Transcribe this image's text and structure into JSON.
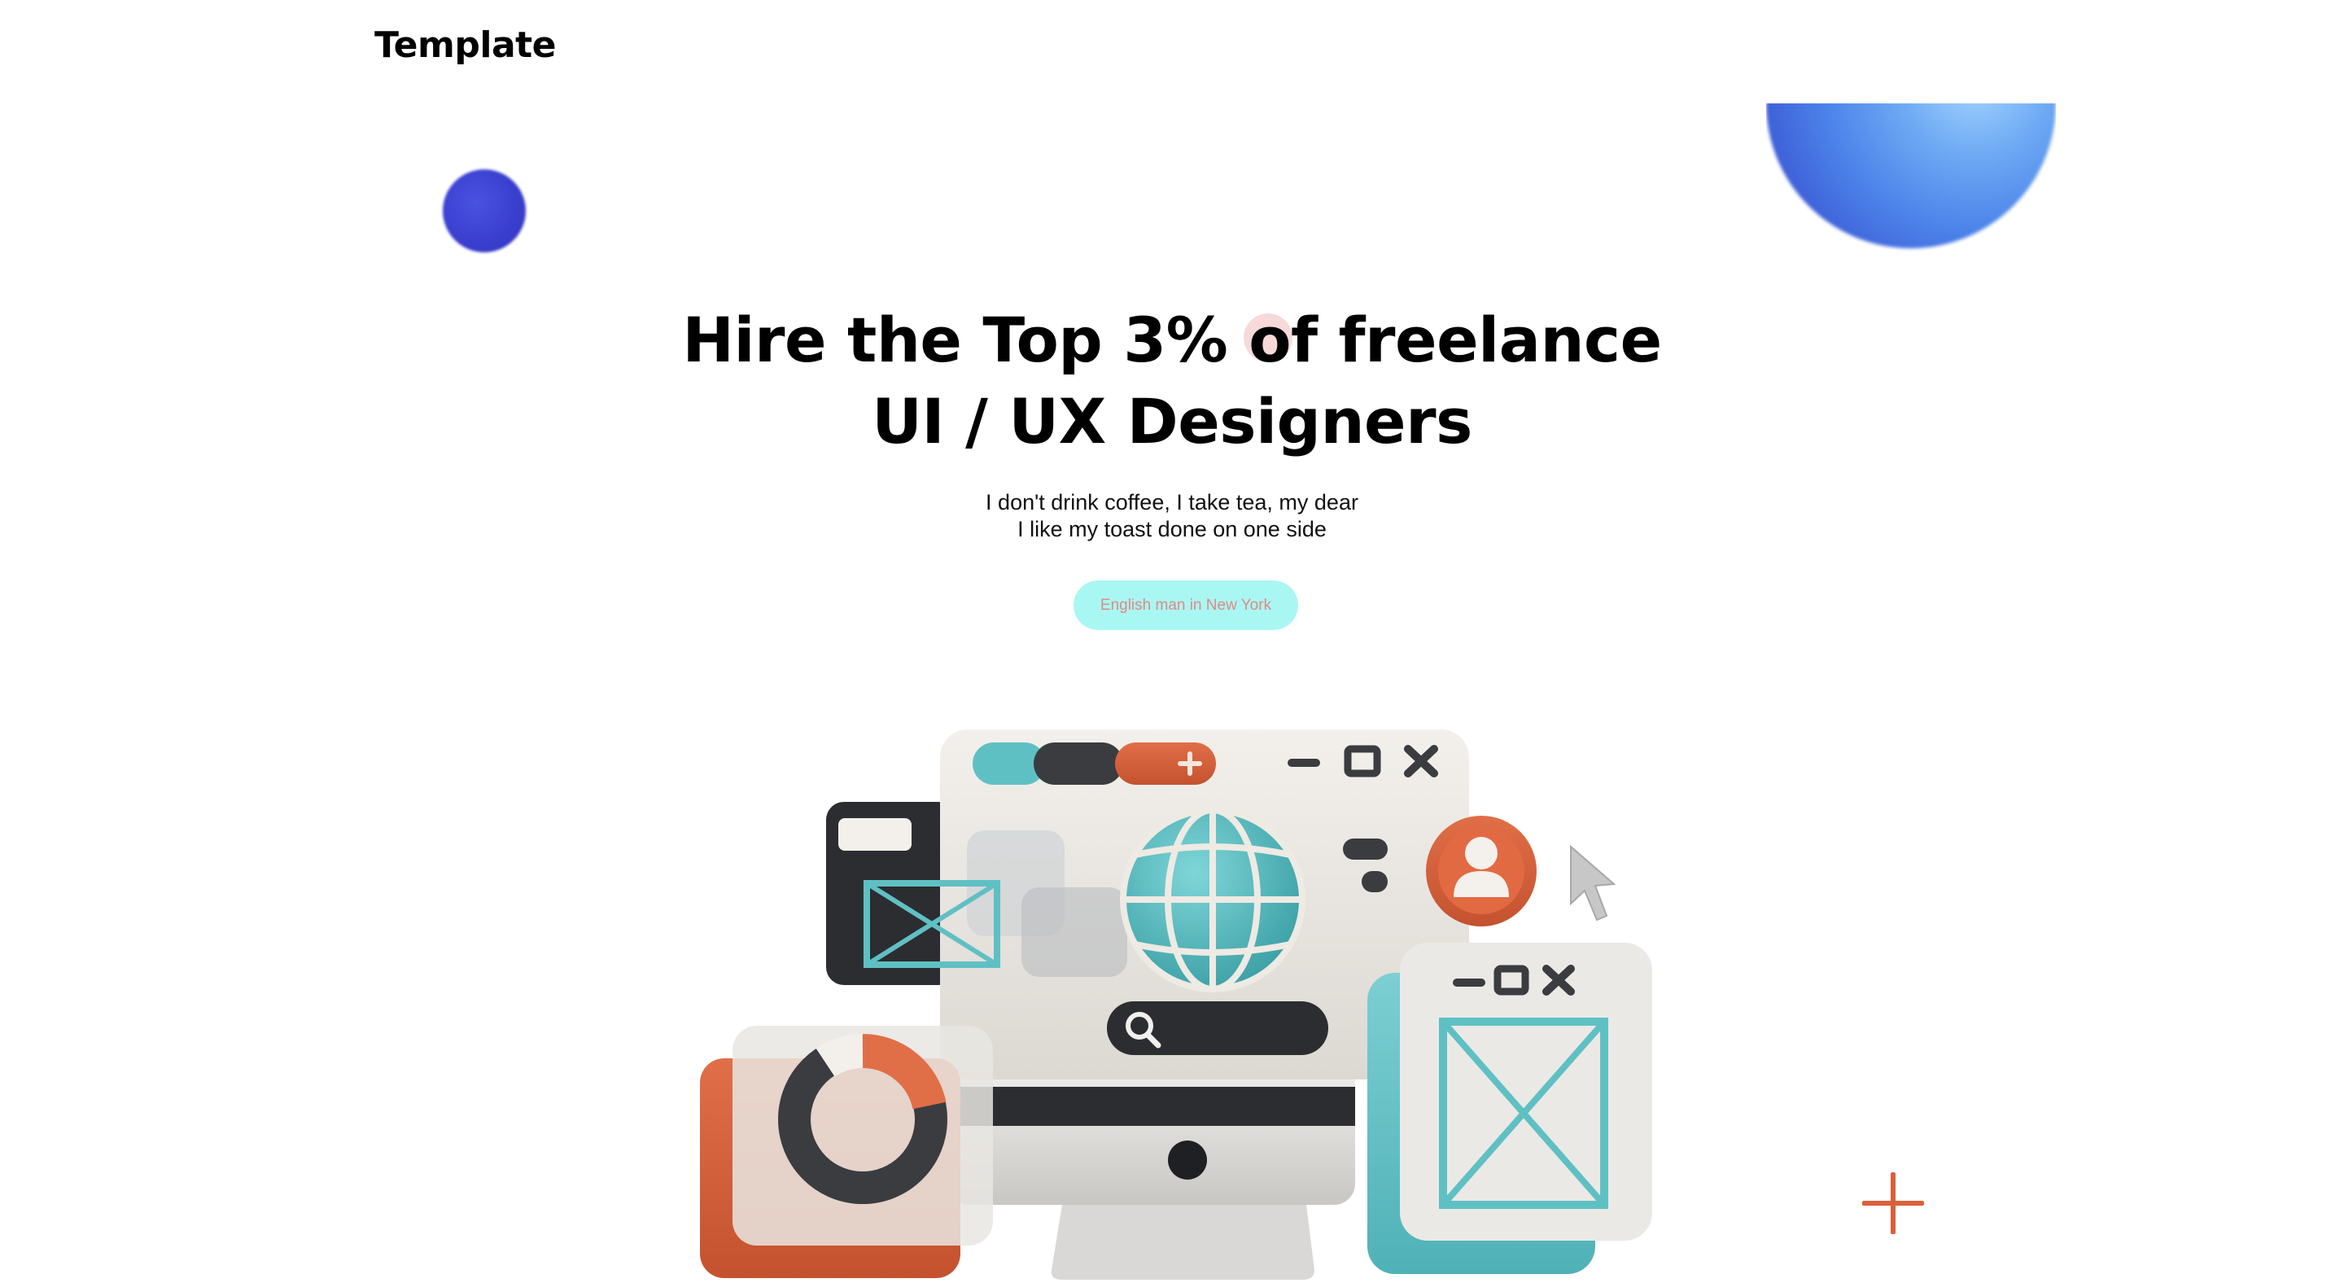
{
  "brand": {
    "name": "Template"
  },
  "hero": {
    "title_line1_before": "Hire the Top 3% ",
    "title_line1_highlight": "of",
    "title_line1_after": " freelance",
    "title_line2": "UI / UX Designers",
    "subtitle_line1": "I don't drink coffee, I take tea, my dear",
    "subtitle_line2": "I like my toast done on one side",
    "cta_label": "English man in New York"
  },
  "colors": {
    "cta_background": "#a9f7f3",
    "cta_text": "#e08a86",
    "accent_orange": "#d8613c",
    "accent_teal": "#5fc4c8",
    "blob_blue": "#4d85ea",
    "blob_indigo": "#3a3fd0"
  },
  "illustration": {
    "icons": [
      "browser-window-icon",
      "globe-icon",
      "user-avatar-icon",
      "cursor-icon",
      "search-bar-icon",
      "donut-chart-icon",
      "image-placeholder-icon",
      "monitor-icon"
    ]
  }
}
